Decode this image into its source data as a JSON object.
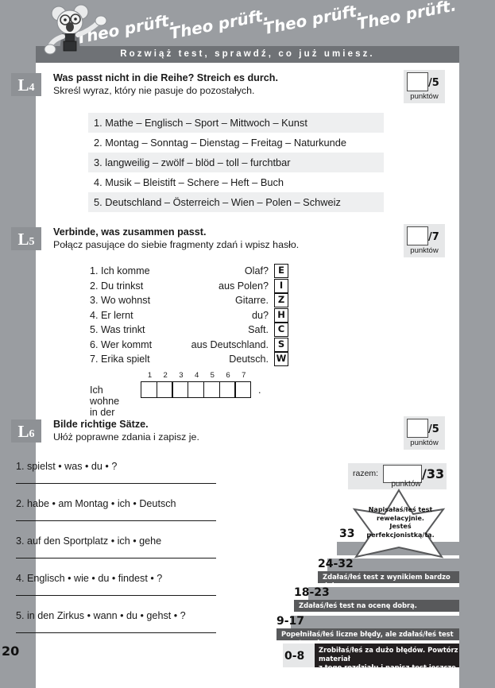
{
  "header": {
    "script_text": "Theo prüft. Theo prüft. Theo prüft. Theo prüft.",
    "script_repeats": [
      "Theo prüft.",
      "Theo prüft.",
      "Theo prüft.",
      "Theo prüft."
    ],
    "subtitle": "Rozwiąż test, sprawdź, co już umiesz.",
    "mascot_name": "theo-koala-mascot"
  },
  "exercises": [
    {
      "tag_letter": "L",
      "tag_number": "4",
      "title_de": "Was passt nicht in die Reihe? Streich es durch.",
      "title_pl": "Skreśl wyraz, który nie pasuje do pozostałych.",
      "points_max": "/5",
      "points_caption": "punktów",
      "items": [
        "1. Mathe – Englisch – Sport – Mittwoch – Kunst",
        "2. Montag – Sonntag – Dienstag  – Freitag – Naturkunde",
        "3. langweilig – zwölf – blöd – toll – furchtbar",
        "4. Musik – Bleistift – Schere – Heft – Buch",
        "5. Deutschland – Österreich – Wien – Polen – Schweiz"
      ]
    },
    {
      "tag_letter": "L",
      "tag_number": "5",
      "title_de": "Verbinde, was zusammen passt.",
      "title_pl": "Połącz pasujące do siebie fragmenty zdań i wpisz hasło.",
      "points_max": "/7",
      "points_caption": "punktów",
      "pairs": [
        {
          "left": "1. Ich komme",
          "right": "Olaf?",
          "letter": "E"
        },
        {
          "left": "2. Du trinkst",
          "right": "aus Polen?",
          "letter": "I"
        },
        {
          "left": "3. Wo wohnst",
          "right": "Gitarre.",
          "letter": "Z"
        },
        {
          "left": "4. Er lernt",
          "right": "du?",
          "letter": "H"
        },
        {
          "left": "5. Was trinkt",
          "right": "Saft.",
          "letter": "C"
        },
        {
          "left": "6. Wer kommt",
          "right": "aus Deutschland.",
          "letter": "S"
        },
        {
          "left": "7. Erika spielt",
          "right": "Deutsch.",
          "letter": "W"
        }
      ],
      "haslo_label": "Ich wohne in der",
      "haslo_numbers": [
        "1",
        "2",
        "3",
        "4",
        "5",
        "6",
        "7"
      ],
      "haslo_period": "."
    },
    {
      "tag_letter": "L",
      "tag_number": "6",
      "title_de": "Bilde richtige Sätze.",
      "title_pl": "Ułóż poprawne zdania i zapisz je.",
      "points_max": "/5",
      "points_caption": "punktów",
      "items": [
        "1. spielst • was • du • ?",
        "2. habe • am Montag • ich • Deutsch",
        "3. auf den Sportplatz • ich • gehe",
        "4. Englisch • wie • du • findest • ?",
        "5. in den Zirkus • wann • du • gehst • ?"
      ]
    }
  ],
  "scoring": {
    "razem_label": "razem:",
    "razem_max": "/33",
    "razem_caption": "punktów",
    "star_message": "Napisałaś/łeś test rewelacyjnie. Jesteś perfekcjonistką/tą.",
    "star_message_lines": [
      "Napisałaś/łeś test",
      "rewelacyjnie.",
      "Jesteś",
      "perfekcjonistką/tą."
    ],
    "tiers": [
      {
        "score": "33",
        "message": "Napisałaś/łeś test rewelacyjnie. Jesteś perfekcjonistką/tą."
      },
      {
        "score": "24-32",
        "message": "Zdałaś/łeś test z wynikiem bardzo dobrym."
      },
      {
        "score": "18-23",
        "message": "Zdałaś/łeś test na ocenę dobrą."
      },
      {
        "score": "9-17",
        "message": "Popełniłaś/łeś liczne błędy, ale zdałaś/łeś test pozytywnie."
      },
      {
        "score": "0-8",
        "message_line1": "Zrobiłaś/łeś za dużo błędów. Powtórz materiał",
        "message_line2": "z tego rozdziału i napisz test jeszcze raz."
      }
    ]
  },
  "page_number": "20",
  "colors": {
    "page_background": "#9a9da1",
    "banner": "#6f7276",
    "tag": "#8e9195",
    "stripe": "#eeeff0",
    "points_box": "#e6e7e8",
    "message_bar": "#58595b",
    "message_bar_dark": "#231f20"
  }
}
